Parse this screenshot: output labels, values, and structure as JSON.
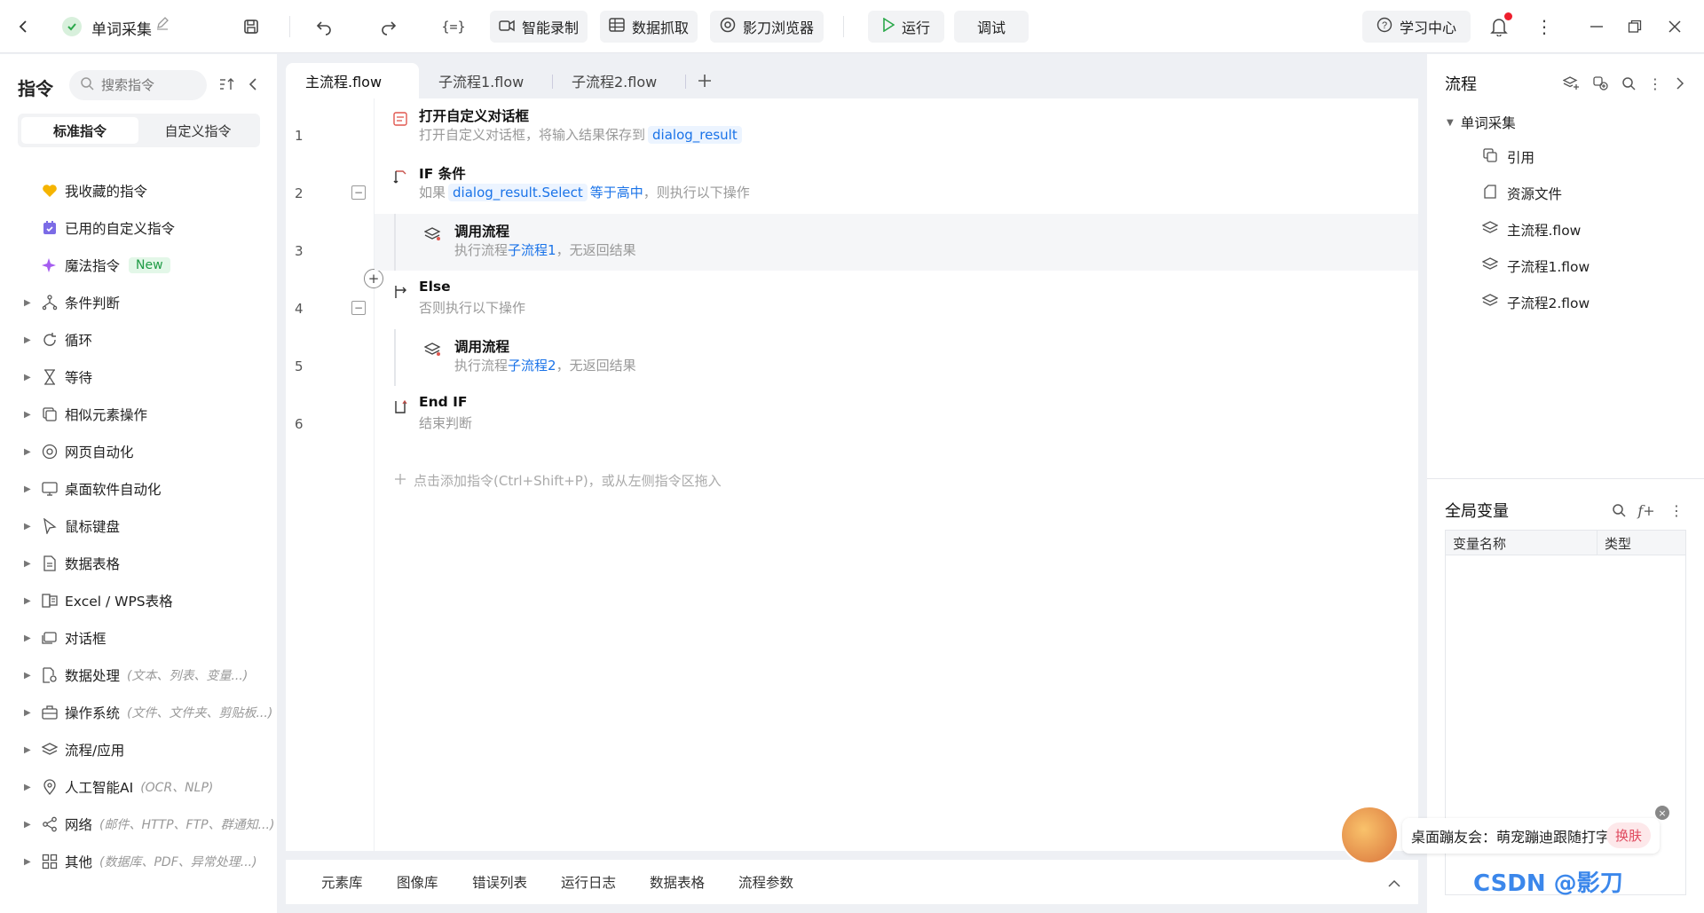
{
  "topbar": {
    "app_title": "单词采集",
    "smart_record": "智能录制",
    "data_capture": "数据抓取",
    "browser": "影刀浏览器",
    "run": "运行",
    "debug": "调试",
    "learning_center": "学习中心"
  },
  "left": {
    "title": "指令",
    "search_placeholder": "搜索指令",
    "tab_standard": "标准指令",
    "tab_custom": "自定义指令",
    "items": [
      {
        "label": "我收藏的指令",
        "icon": "heart-icon"
      },
      {
        "label": "已用的自定义指令",
        "icon": "calendar-icon"
      },
      {
        "label": "魔法指令",
        "icon": "sparkle-icon",
        "badge": "New"
      },
      {
        "label": "条件判断",
        "icon": "branch-icon"
      },
      {
        "label": "循环",
        "icon": "loop-icon"
      },
      {
        "label": "等待",
        "icon": "hourglass-icon"
      },
      {
        "label": "相似元素操作",
        "icon": "copy-icon"
      },
      {
        "label": "网页自动化",
        "icon": "chrome-icon"
      },
      {
        "label": "桌面软件自动化",
        "icon": "monitor-icon"
      },
      {
        "label": "鼠标键盘",
        "icon": "cursor-icon"
      },
      {
        "label": "数据表格",
        "icon": "document-icon"
      },
      {
        "label": "Excel / WPS表格",
        "icon": "excel-icon"
      },
      {
        "label": "对话框",
        "icon": "dialog-icon"
      },
      {
        "label": "数据处理",
        "icon": "data-icon",
        "hint": "(文本、列表、变量...)"
      },
      {
        "label": "操作系统",
        "icon": "briefcase-icon",
        "hint": "(文件、文件夹、剪贴板...)"
      },
      {
        "label": "流程/应用",
        "icon": "layers-icon"
      },
      {
        "label": "人工智能AI",
        "icon": "location-icon",
        "hint": "(OCR、NLP)"
      },
      {
        "label": "网络",
        "icon": "share-icon",
        "hint": "(邮件、HTTP、FTP、群通知...)"
      },
      {
        "label": "其他",
        "icon": "grid-icon",
        "hint": "(数据库、PDF、异常处理...)"
      }
    ]
  },
  "tabs": [
    "主流程.flow",
    "子流程1.flow",
    "子流程2.flow"
  ],
  "editor": {
    "lines": [
      "1",
      "2",
      "3",
      "4",
      "5",
      "6"
    ],
    "s1": {
      "title": "打开自定义对话框",
      "desc": "打开自定义对话框，将输入结果保存到",
      "var": "dialog_result"
    },
    "s2": {
      "title": "IF 条件",
      "prefix": "如果",
      "var": "dialog_result.Select",
      "op": "等于高中",
      "suffix": "，则执行以下操作"
    },
    "s3": {
      "title": "调用流程",
      "prefix": "执行流程",
      "flow": "子流程1",
      "suffix": "，无返回结果"
    },
    "s4": {
      "title": "Else",
      "desc": "否则执行以下操作"
    },
    "s5": {
      "title": "调用流程",
      "prefix": "执行流程",
      "flow": "子流程2",
      "suffix": "，无返回结果"
    },
    "s6": {
      "title": "End IF",
      "desc": "结束判断"
    },
    "add_hint": "点击添加指令(Ctrl+Shift+P)，或从左侧指令区拖入"
  },
  "bottom_tabs": [
    "元素库",
    "图像库",
    "错误列表",
    "运行日志",
    "数据表格",
    "流程参数"
  ],
  "right": {
    "flow_title": "流程",
    "root": "单词采集",
    "items": [
      "引用",
      "资源文件",
      "主流程.flow",
      "子流程1.flow",
      "子流程2.flow"
    ],
    "vars_title": "全局变量",
    "col_name": "变量名称",
    "col_type": "类型"
  },
  "promo": {
    "text": "桌面蹦友会：萌宠蹦迪跟随打字",
    "button": "换肤"
  },
  "watermark": "CSDN @影刀"
}
